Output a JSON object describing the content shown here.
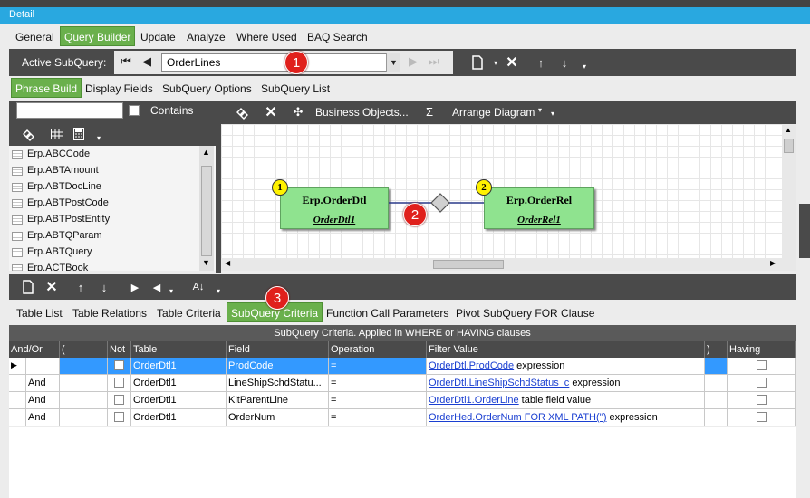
{
  "window": {
    "title": "Detail"
  },
  "main_tabs": [
    {
      "label": "General",
      "active": false
    },
    {
      "label": "Query Builder",
      "active": true
    },
    {
      "label": "Update",
      "active": false
    },
    {
      "label": "Analyze",
      "active": false
    },
    {
      "label": "Where Used",
      "active": false
    },
    {
      "label": "BAQ Search",
      "active": false
    }
  ],
  "subquery": {
    "label": "Active SubQuery:",
    "value": "OrderLines"
  },
  "sub_tabs": [
    {
      "label": "Phrase Build",
      "active": true
    },
    {
      "label": "Display Fields",
      "active": false
    },
    {
      "label": "SubQuery Options",
      "active": false
    },
    {
      "label": "SubQuery List",
      "active": false
    }
  ],
  "search": {
    "value": "",
    "contains_label": "Contains",
    "contains_checked": false
  },
  "table_list": [
    "Erp.ABCCode",
    "Erp.ABTAmount",
    "Erp.ABTDocLine",
    "Erp.ABTPostCode",
    "Erp.ABTPostEntity",
    "Erp.ABTQParam",
    "Erp.ABTQuery",
    "Erp.ACTBook"
  ],
  "diagram_toolbar": {
    "business_objects": "Business Objects...",
    "sigma": "Σ",
    "arrange": "Arrange Diagram"
  },
  "diagram": {
    "nodes": [
      {
        "badge": "1",
        "title": "Erp.OrderDtl",
        "alias": "OrderDtl1"
      },
      {
        "badge": "2",
        "title": "Erp.OrderRel",
        "alias": "OrderRel1"
      }
    ]
  },
  "callouts": [
    "1",
    "2",
    "3"
  ],
  "bottom_tabs": [
    {
      "label": "Table List",
      "active": false
    },
    {
      "label": "Table Relations",
      "active": false
    },
    {
      "label": "Table Criteria",
      "active": false
    },
    {
      "label": "SubQuery Criteria",
      "active": true
    },
    {
      "label": "Function Call Parameters",
      "active": false
    },
    {
      "label": "Pivot SubQuery FOR Clause",
      "active": false
    }
  ],
  "criteria": {
    "caption": "SubQuery Criteria. Applied in WHERE or HAVING clauses",
    "columns": [
      "And/Or",
      "(",
      "Not",
      "Table",
      "Field",
      "Operation",
      "Filter Value",
      ")",
      "Having"
    ],
    "rows": [
      {
        "andor": "",
        "not": false,
        "table": "OrderDtl1",
        "field": "ProdCode",
        "op": "=",
        "filter_link": "OrderDtl.ProdCode",
        "filter_text": "expression",
        "having": false,
        "selected": true
      },
      {
        "andor": "And",
        "not": false,
        "table": "OrderDtl1",
        "field": "LineShipSchdStatu...",
        "op": "=",
        "filter_link": "OrderDtl.LineShipSchdStatus_c",
        "filter_text": "expression",
        "having": false,
        "selected": false
      },
      {
        "andor": "And",
        "not": false,
        "table": "OrderDtl1",
        "field": "KitParentLine",
        "op": "=",
        "filter_link": "OrderDtl1.OrderLine",
        "filter_text": "table field value",
        "having": false,
        "selected": false
      },
      {
        "andor": "And",
        "not": false,
        "table": "OrderDtl1",
        "field": "OrderNum",
        "op": "=",
        "filter_link": "OrderHed.OrderNum FOR XML PATH('')",
        "filter_text": "expression",
        "having": false,
        "selected": false
      }
    ]
  },
  "colors": {
    "accent_green": "#6ab04c",
    "title_blue": "#29a8e0",
    "toolbar_dark": "#4a4a4a",
    "selection_blue": "#3399ff",
    "node_green": "#8fe38f"
  }
}
